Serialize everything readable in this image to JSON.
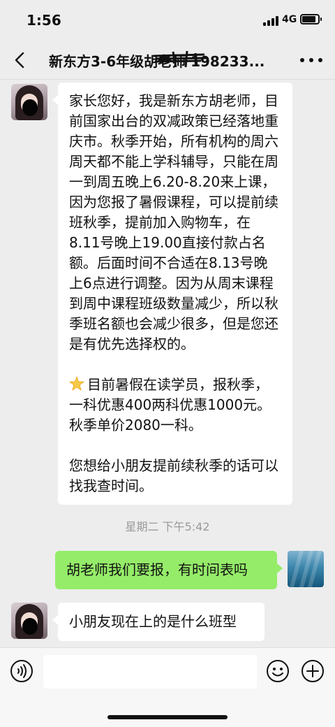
{
  "status_bar": {
    "time": "1:56",
    "network": "4G",
    "battery_level": 0.8
  },
  "nav": {
    "title": "新东方3-6年级胡老师 198233...",
    "back_icon": "chevron-left-icon",
    "more_icon": "more-dots-icon"
  },
  "messages": [
    {
      "side": "left",
      "paragraphs": [
        "家长您好，我是新东方胡老师，目前国家出台的双减政策已经落地重庆市。秋季开始，所有机构的周六周天都不能上学科辅导，只能在周一到周五晚上6.20-8.20来上课，因为您报了暑假课程，可以提前续班秋季，提前加入购物车，在8.11号晚上19.00直接付款占名额。后面时间不合适在8.13号晚上6点进行调整。因为从周末课程到周中课程班级数量减少，所以秋季班名额也会减少很多，但是您还是有优先选择权的。",
        "目前暑假在读学员，报秋季，一科优惠400两科优惠1000元。秋季单价2080一科。",
        "您想给小朋友提前续秋季的话可以找我查时间。"
      ],
      "emoji_icon": "glowing-star-icon"
    },
    {
      "side": "right",
      "text": "胡老师我们要报，有时间表吗"
    },
    {
      "side": "left",
      "text": "小朋友现在上的是什么班型"
    }
  ],
  "timestamp": "星期二 下午5:42",
  "input_bar": {
    "placeholder": "",
    "voice_icon": "voice-icon",
    "emoji_icon": "emoji-icon",
    "plus_icon": "plus-icon"
  },
  "colors": {
    "background": "#ededed",
    "bubble_self": "#95ec69",
    "bubble_other": "#ffffff"
  }
}
